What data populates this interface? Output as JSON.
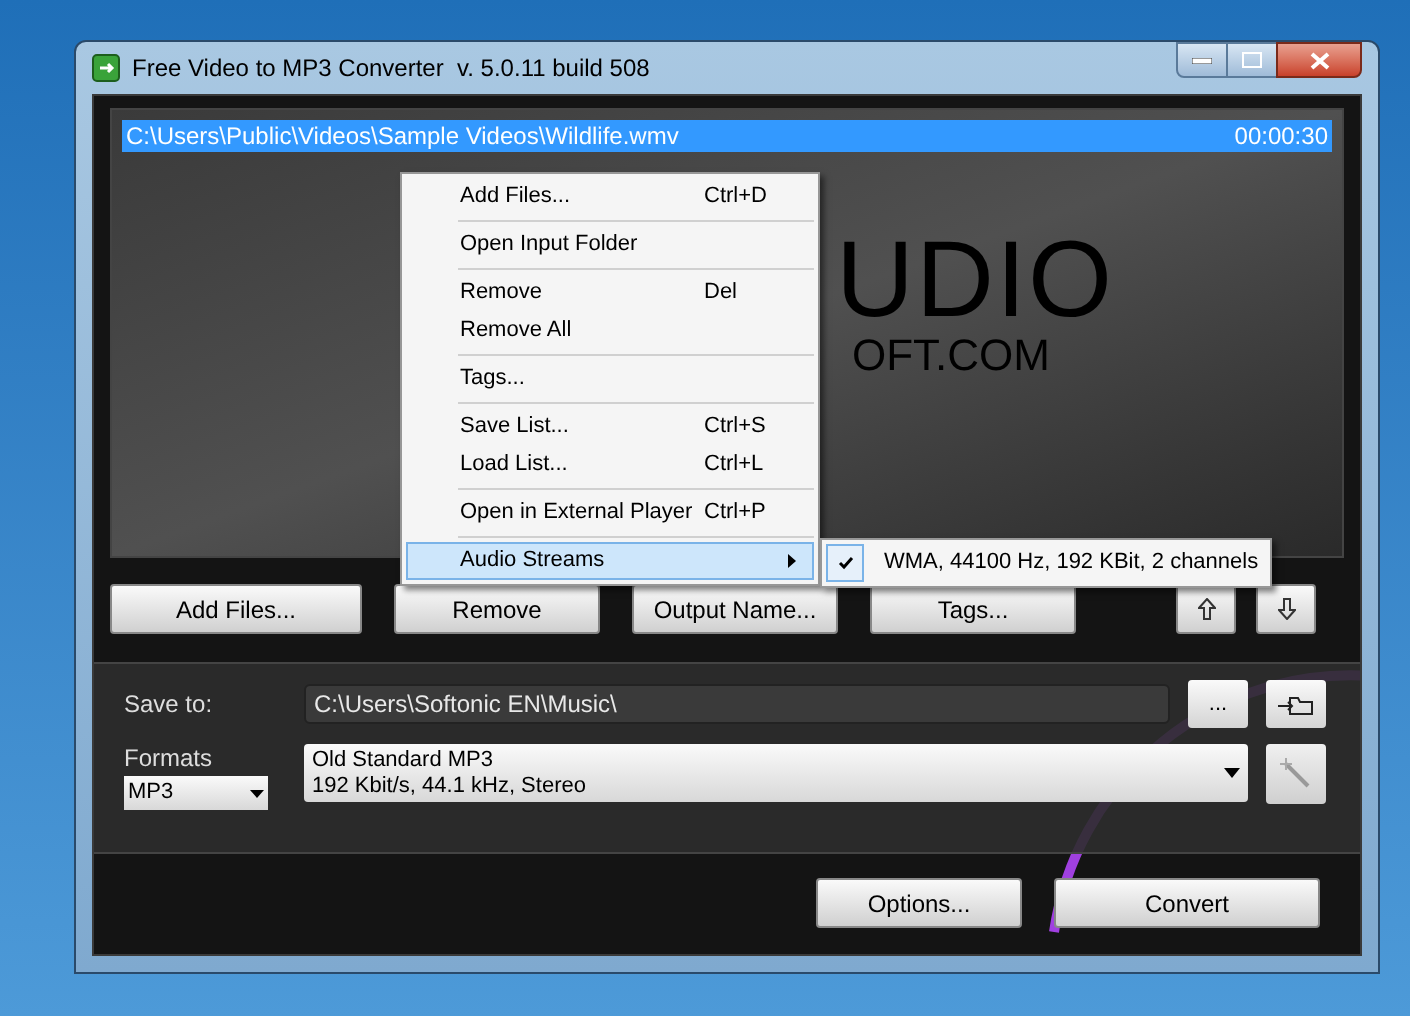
{
  "window": {
    "title": "Free Video to MP3 Converter  v. 5.0.11 build 508"
  },
  "file_list": {
    "rows": [
      {
        "path": "C:\\Users\\Public\\Videos\\Sample Videos\\Wildlife.wmv",
        "duration": "00:00:30",
        "selected": true
      }
    ],
    "background_logo": {
      "line_1": "UDIO",
      "line_2": "OFT.COM"
    }
  },
  "context_menu": {
    "groups": [
      [
        {
          "label": "Add Files...",
          "shortcut": "Ctrl+D",
          "selected": false,
          "submenu": false
        }
      ],
      [
        {
          "label": "Open Input Folder",
          "selected": false,
          "submenu": false
        }
      ],
      [
        {
          "label": "Remove",
          "shortcut": "Del",
          "selected": false,
          "submenu": false
        },
        {
          "label": "Remove All",
          "selected": false,
          "submenu": false
        }
      ],
      [
        {
          "label": "Tags...",
          "selected": false,
          "submenu": false
        }
      ],
      [
        {
          "label": "Save List...",
          "shortcut": "Ctrl+S",
          "selected": false,
          "submenu": false
        },
        {
          "label": "Load List...",
          "shortcut": "Ctrl+L",
          "selected": false,
          "submenu": false
        }
      ],
      [
        {
          "label": "Open in External Player",
          "shortcut": "Ctrl+P",
          "selected": false,
          "submenu": false
        }
      ],
      [
        {
          "label": "Audio Streams",
          "selected": true,
          "submenu": true
        }
      ]
    ],
    "submenu": [
      {
        "label": "WMA, 44100 Hz, 192 KBit, 2 channels",
        "checked": true
      }
    ]
  },
  "list_buttons": [
    "Add Files...",
    "Remove",
    "Output Name...",
    "Tags..."
  ],
  "save_to": {
    "label": "Save to:",
    "value": "C:\\Users\\Softonic EN\\Music\\",
    "browse_button": "..."
  },
  "formats": {
    "label": "Formats",
    "format": "MP3",
    "preset_line_1": "Old Standard MP3",
    "preset_line_2": "192 Kbit/s, 44.1 kHz, Stereo"
  },
  "bottom_buttons": [
    "Options...",
    "Convert"
  ]
}
